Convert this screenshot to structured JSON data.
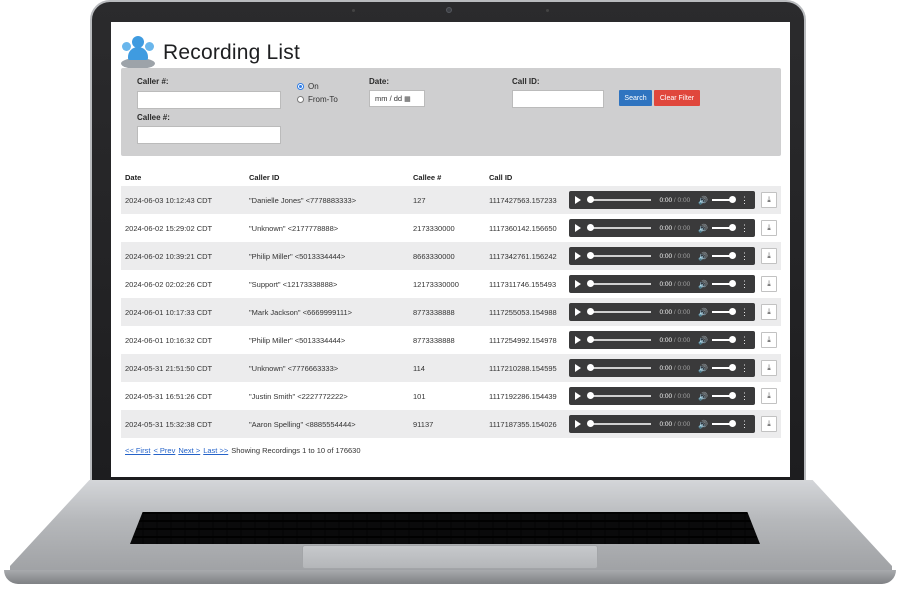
{
  "page": {
    "title": "Recording List"
  },
  "filter": {
    "caller_label": "Caller #:",
    "caller_value": "",
    "callee_label": "Callee #:",
    "callee_value": "",
    "radio_on": "On",
    "radio_from_to": "From-To",
    "date_label": "Date:",
    "date_placeholder": "mm / dd",
    "callid_label": "Call ID:",
    "callid_value": "",
    "search_button": "Search",
    "clear_button": "Clear Filter"
  },
  "table": {
    "headers": {
      "date": "Date",
      "caller": "Caller ID",
      "callee": "Callee #",
      "callid": "Call ID"
    },
    "rows": [
      {
        "date": "2024-06-03 10:12:43 CDT",
        "caller": "\"Danielle Jones\" <7778883333>",
        "callee": "127",
        "callid": "1117427563.157233"
      },
      {
        "date": "2024-06-02 15:29:02 CDT",
        "caller": "\"Unknown\" <2177778888>",
        "callee": "2173330000",
        "callid": "1117360142.156650"
      },
      {
        "date": "2024-06-02 10:39:21 CDT",
        "caller": "\"Philip Miller\" <5013334444>",
        "callee": "8663330000",
        "callid": "1117342761.156242"
      },
      {
        "date": "2024-06-02 02:02:26 CDT",
        "caller": "\"Support\" <12173338888>",
        "callee": "12173330000",
        "callid": "1117311746.155493"
      },
      {
        "date": "2024-06-01 10:17:33 CDT",
        "caller": "\"Mark Jackson\" <6669999111>",
        "callee": "8773338888",
        "callid": "1117255053.154988"
      },
      {
        "date": "2024-06-01 10:16:32 CDT",
        "caller": "\"Philip Miller\" <5013334444>",
        "callee": "8773338888",
        "callid": "1117254992.154978"
      },
      {
        "date": "2024-05-31 21:51:50 CDT",
        "caller": "\"Unknown\" <7776663333>",
        "callee": "114",
        "callid": "1117210288.154595"
      },
      {
        "date": "2024-05-31 16:51:26 CDT",
        "caller": "\"Justin Smith\" <2227772222>",
        "callee": "101",
        "callid": "1117192286.154439"
      },
      {
        "date": "2024-05-31 15:32:38 CDT",
        "caller": "\"Aaron Spelling\" <8885554444>",
        "callee": "91137",
        "callid": "1117187355.154026"
      }
    ],
    "player_time": "0:00",
    "player_duration": "0:00"
  },
  "pager": {
    "first": "<< First",
    "prev": "< Prev",
    "next": "Next >",
    "last": "Last >>",
    "status": "Showing Recordings 1 to 10 of 176630"
  },
  "colors": {
    "accent": "#2f74c0",
    "danger": "#e0473c",
    "filter_bg": "#cfcfd0",
    "player_bg": "#3a3a3b"
  },
  "icons": [
    "users-logo-icon",
    "calendar-icon",
    "play-icon",
    "volume-icon",
    "more-options-icon",
    "download-icon"
  ]
}
